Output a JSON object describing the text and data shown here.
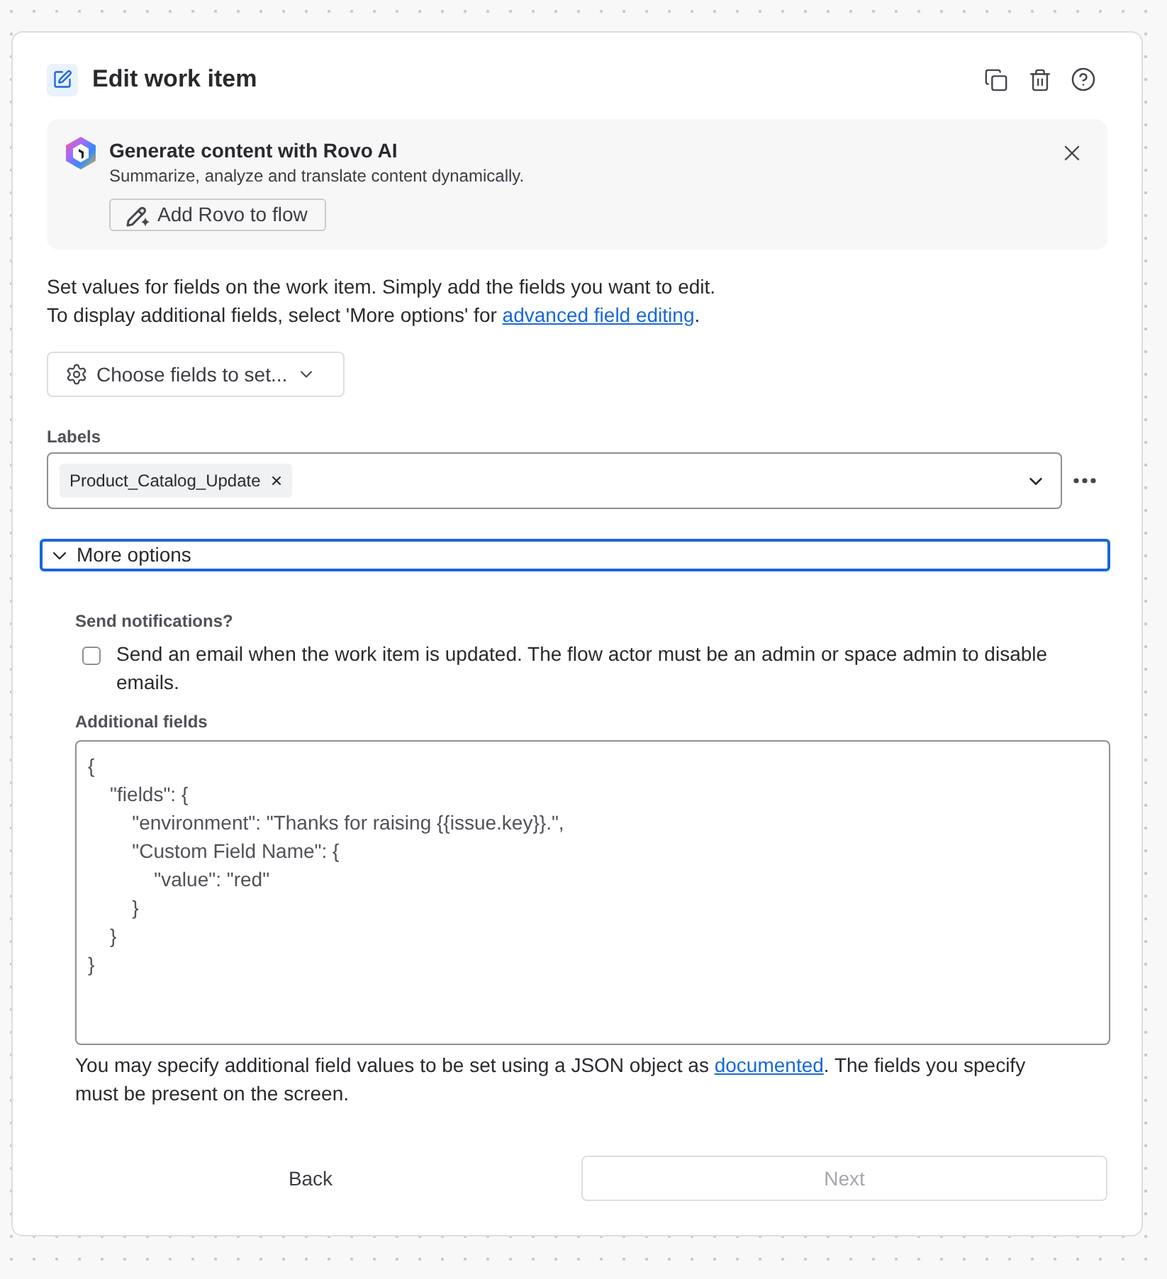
{
  "header": {
    "title": "Edit work item"
  },
  "banner": {
    "title": "Generate content with Rovo AI",
    "description": "Summarize, analyze and translate content dynamically.",
    "button": "Add Rovo to flow"
  },
  "intro": [
    {
      "text": "Set values for fields on the work item. Simply add the fields you want to edit."
    },
    {
      "text": "To display additional fields, select 'More options' for ",
      "link": "advanced field editing",
      "after": "."
    }
  ],
  "choose_fields": {
    "label": "Choose fields to set..."
  },
  "labels_field": {
    "label": "Labels",
    "tags": [
      "Product_Catalog_Update"
    ]
  },
  "more_options": {
    "label": "More options",
    "expanded": true,
    "focused": true
  },
  "notifications": {
    "label": "Send notifications?",
    "checkbox": {
      "label": "Send an email when the work item is updated. The flow actor must be an admin or space admin to disable emails.",
      "checked": false
    }
  },
  "additional_fields": {
    "label": "Additional fields",
    "value": "{\n    \"fields\": {\n        \"environment\": \"Thanks for raising {{issue.key}}.\",\n        \"Custom Field Name\": {\n            \"value\": \"red\"\n        }\n    }\n}",
    "help": {
      "text": "You may specify additional field values to be set using a JSON object as ",
      "link": "documented",
      "after": ". The fields you specify must be present on the screen."
    }
  },
  "buttons": [
    {
      "label": "Back",
      "kind": "subtle",
      "disabled": false
    },
    {
      "label": "Next",
      "kind": "outline",
      "disabled": true
    }
  ]
}
